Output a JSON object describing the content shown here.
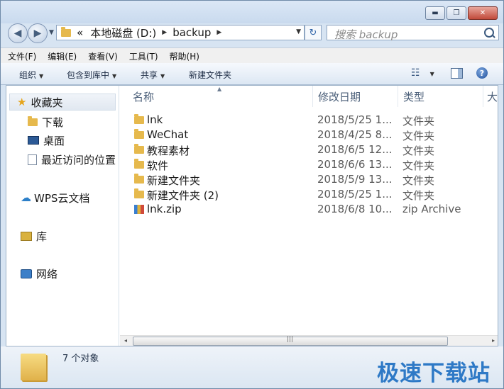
{
  "window": {
    "controls": {
      "minimize": "▬",
      "maximize": "❐",
      "close": "✕"
    }
  },
  "navigation": {
    "back_glyph": "◀",
    "forward_glyph": "▶",
    "address": {
      "prefix": "«",
      "segments": [
        "本地磁盘 (D:)",
        "backup"
      ]
    },
    "refresh_glyph": "↻",
    "search_placeholder": "搜索 backup"
  },
  "menu": [
    "文件(F)",
    "编辑(E)",
    "查看(V)",
    "工具(T)",
    "帮助(H)"
  ],
  "toolbar": {
    "organize": "组织",
    "include_in_library": "包含到库中",
    "share": "共享",
    "new_folder": "新建文件夹",
    "view_glyph": "☷",
    "help_glyph": "?"
  },
  "sidebar": [
    {
      "label": "收藏夹",
      "icon": "star-icon"
    },
    {
      "label": "下载",
      "icon": "download-folder-icon"
    },
    {
      "label": "桌面",
      "icon": "desktop-icon"
    },
    {
      "label": "最近访问的位置",
      "icon": "recent-places-icon"
    },
    {
      "label": "WPS云文档",
      "icon": "cloud-icon"
    },
    {
      "label": "库",
      "icon": "library-icon"
    },
    {
      "label": "网络",
      "icon": "network-icon"
    }
  ],
  "columns": {
    "name": "名称",
    "date": "修改日期",
    "type": "类型",
    "size": "大"
  },
  "files": [
    {
      "name": "lnk",
      "date": "2018/5/25 1...",
      "type": "文件夹",
      "icon": "folder-icon"
    },
    {
      "name": "WeChat",
      "date": "2018/4/25 8...",
      "type": "文件夹",
      "icon": "folder-icon"
    },
    {
      "name": "教程素材",
      "date": "2018/6/5 12...",
      "type": "文件夹",
      "icon": "folder-icon"
    },
    {
      "name": "软件",
      "date": "2018/6/6 13...",
      "type": "文件夹",
      "icon": "folder-icon"
    },
    {
      "name": "新建文件夹",
      "date": "2018/5/9 13...",
      "type": "文件夹",
      "icon": "folder-icon"
    },
    {
      "name": "新建文件夹 (2)",
      "date": "2018/5/25 1...",
      "type": "文件夹",
      "icon": "folder-icon"
    },
    {
      "name": "lnk.zip",
      "date": "2018/6/8 10...",
      "type": "zip Archive",
      "icon": "zip-archive-icon"
    }
  ],
  "scrollbar": {
    "left": "◂",
    "right": "▸",
    "grip": "|||"
  },
  "status": {
    "count_text": "7 个对象"
  },
  "watermark": "极速下载站"
}
